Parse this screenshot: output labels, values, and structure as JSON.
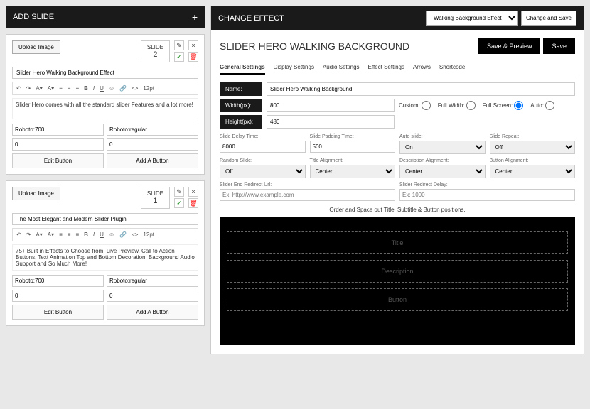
{
  "left": {
    "header": "ADD SLIDE",
    "slides": [
      {
        "upload": "Upload Image",
        "slideLabel": "SLIDE",
        "num": "2",
        "title": "Slider Hero Walking Background Effect",
        "content": "Slider Hero comes with all the standard slider Features and a lot more!",
        "font1": "Roboto:700",
        "font2": "Roboto:regular",
        "z1": "0",
        "z2": "0",
        "editBtn": "Edit Button",
        "addBtn": "Add A Button"
      },
      {
        "upload": "Upload Image",
        "slideLabel": "SLIDE",
        "num": "1",
        "title": "The Most Elegant and Modern Slider Plugin",
        "content": "75+ Built in Effects to Choose from, Live Preview, Call to Action Buttons, Text Animation\nTop and Bottom Decoration, Background Audio Support and So Much More!",
        "font1": "Roboto:700",
        "font2": "Roboto:regular",
        "z1": "0",
        "z2": "0",
        "editBtn": "Edit Button",
        "addBtn": "Add A Button"
      }
    ]
  },
  "right": {
    "header": "CHANGE EFFECT",
    "effectSelect": "Walking Background Effect",
    "changeSave": "Change and Save",
    "pageTitle": "SLIDER HERO WALKING BACKGROUND",
    "savePreview": "Save & Preview",
    "save": "Save",
    "tabs": [
      "General Settings",
      "Display Settings",
      "Audio Settings",
      "Effect Settings",
      "Arrows",
      "Shortcode"
    ],
    "nameLabel": "Name:",
    "nameVal": "Slider Hero Walking Background",
    "widthLabel": "Width(px):",
    "widthVal": "800",
    "heightLabel": "Height(px):",
    "heightVal": "480",
    "radios": {
      "custom": "Custom:",
      "full": "Full Width:",
      "screen": "Full Screen:",
      "auto": "Auto:"
    },
    "row1": {
      "delay": "Slide Delay Time:",
      "delayVal": "8000",
      "padding": "Slide Padding Time:",
      "paddingVal": "500",
      "auto": "Auto slide:",
      "autoVal": "On",
      "repeat": "Slide Repeat:",
      "repeatVal": "Off"
    },
    "row2": {
      "random": "Random Slide:",
      "randomVal": "Off",
      "title": "Title Alignment:",
      "titleVal": "Center",
      "desc": "Description Alignment:",
      "descVal": "Center",
      "btn": "Button Alignment:",
      "btnVal": "Center"
    },
    "row3": {
      "url": "Slider End Redirect Url:",
      "urlPh": "Ex: http://www.example.com",
      "delay": "Slider Redirect Delay:",
      "delayPh": "Ex: 1000"
    },
    "previewText": "Order and Space out Title, Subtitle & Button positions.",
    "previewTitle": "Title",
    "previewDesc": "Description",
    "previewBtn": "Button"
  },
  "toolbar": {
    "size": "12pt"
  }
}
